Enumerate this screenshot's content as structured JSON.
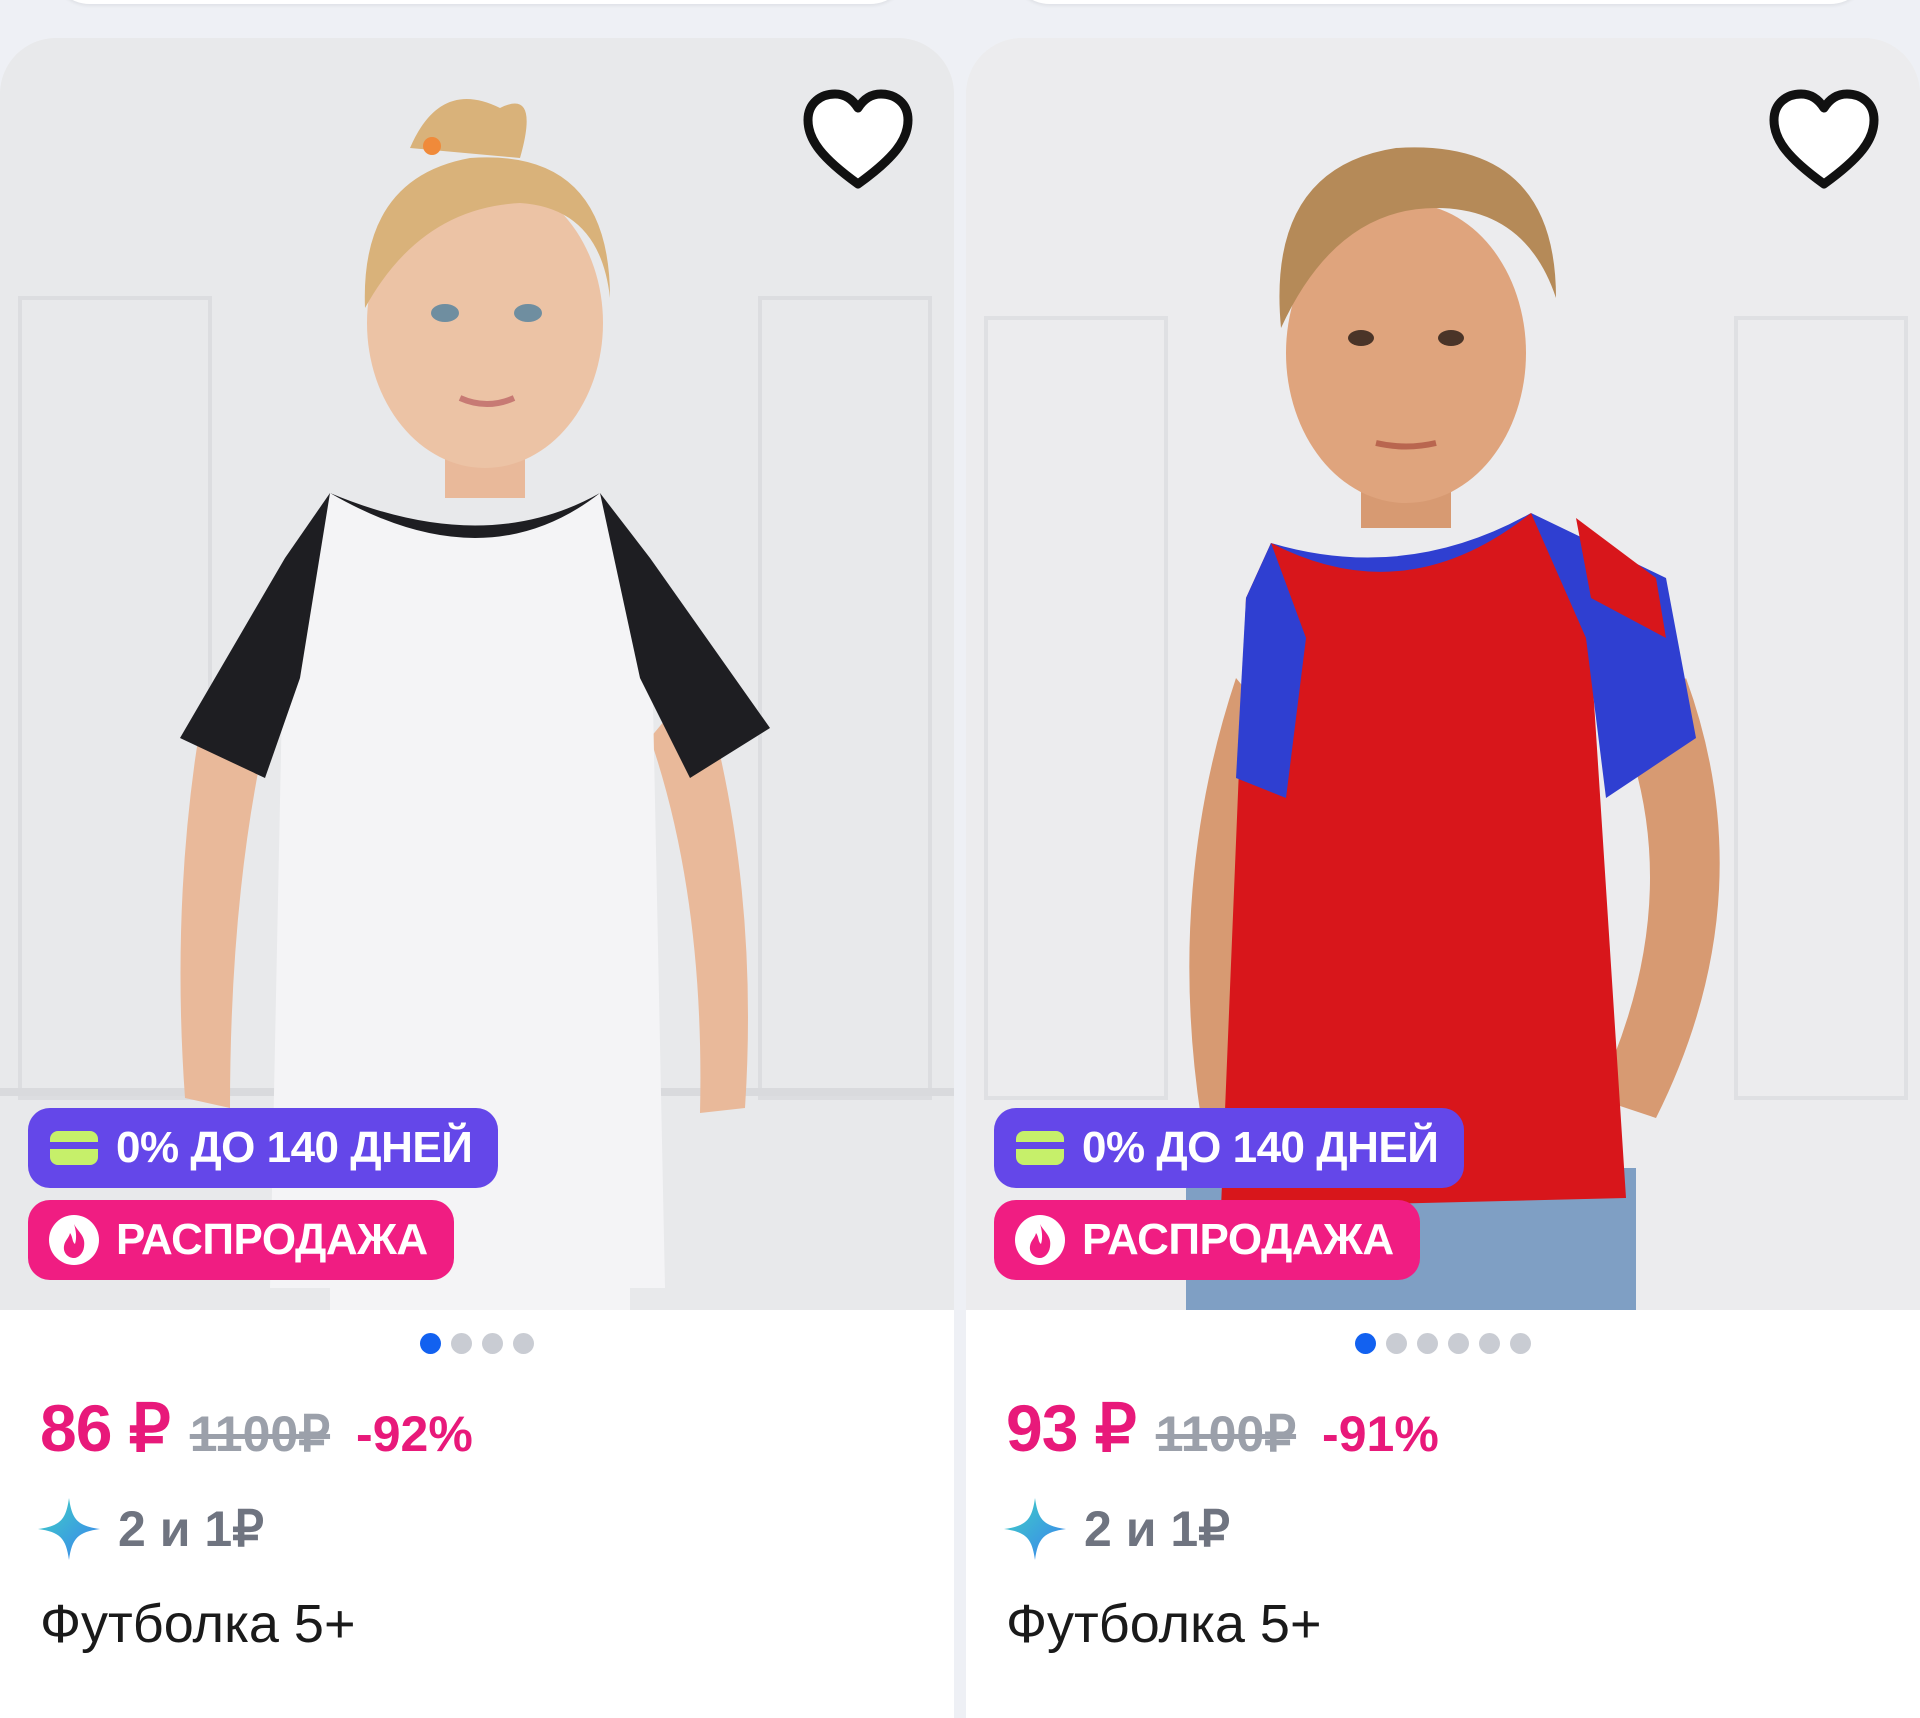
{
  "products": [
    {
      "image_alt": "Девочка в белой футболке с чёрными рукавами",
      "badges": {
        "credit": "0% ДО 140 ДНЕЙ",
        "sale": "РАСПРОДАЖА"
      },
      "gallery_pages": 4,
      "gallery_active": 1,
      "price": "86 ₽",
      "old_price": "1100₽",
      "discount": "-92%",
      "promo": "2 и 1₽",
      "title": "Футболка 5+"
    },
    {
      "image_alt": "Мальчик в красной футболке с синими рукавами",
      "badges": {
        "credit": "0% ДО 140 ДНЕЙ",
        "sale": "РАСПРОДАЖА"
      },
      "gallery_pages": 6,
      "gallery_active": 1,
      "price": "93 ₽",
      "old_price": "1100₽",
      "discount": "-91%",
      "promo": "2 и 1₽",
      "title": "Футболка 5+"
    }
  ],
  "colors": {
    "price": "#e8197a",
    "credit_badge": "#6447e9",
    "sale_badge": "#f01d82",
    "dot_active": "#1261f0",
    "dot_inactive": "#c9ccd3"
  },
  "icons": {
    "favorite": "heart-icon",
    "credit": "card-icon",
    "sale": "flame-icon",
    "promo": "sparkle-icon"
  }
}
